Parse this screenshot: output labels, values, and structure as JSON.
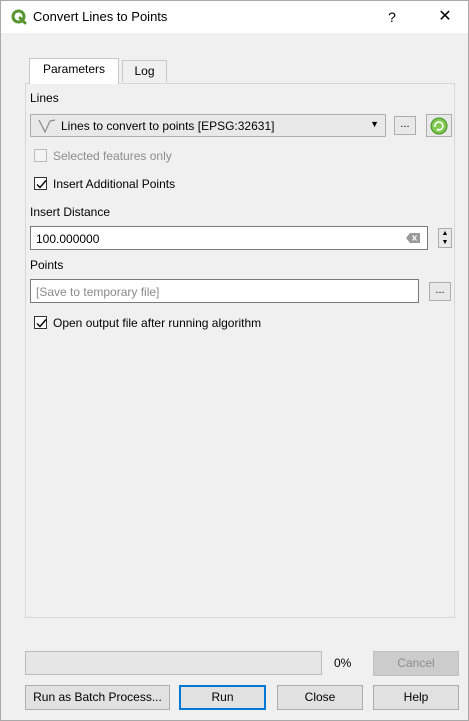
{
  "window": {
    "title": "Convert Lines to Points",
    "help_glyph": "?",
    "close_glyph": "✕"
  },
  "tabs": [
    {
      "label": "Parameters",
      "active": true
    },
    {
      "label": "Log",
      "active": false
    }
  ],
  "params": {
    "lines_label": "Lines",
    "lines_value": "Lines to convert to points [EPSG:32631]",
    "lines_icon": "line-layer-icon",
    "browse_glyph": "...",
    "iterate_icon": "iterate-icon",
    "selected_only_label": "Selected features only",
    "selected_only_checked": false,
    "insert_points_label": "Insert Additional Points",
    "insert_points_checked": true,
    "insert_distance_label": "Insert Distance",
    "insert_distance_value": "100.000000",
    "points_label": "Points",
    "points_placeholder": "[Save to temporary file]",
    "open_output_label": "Open output file after running algorithm",
    "open_output_checked": true
  },
  "footer": {
    "progress_value": 0,
    "progress_text": "0%",
    "cancel_label": "Cancel",
    "batch_label": "Run as Batch Process...",
    "run_label": "Run",
    "close_label": "Close",
    "help_label": "Help"
  },
  "colors": {
    "qgis_green": "#589632",
    "accent_blue": "#0078d7"
  }
}
